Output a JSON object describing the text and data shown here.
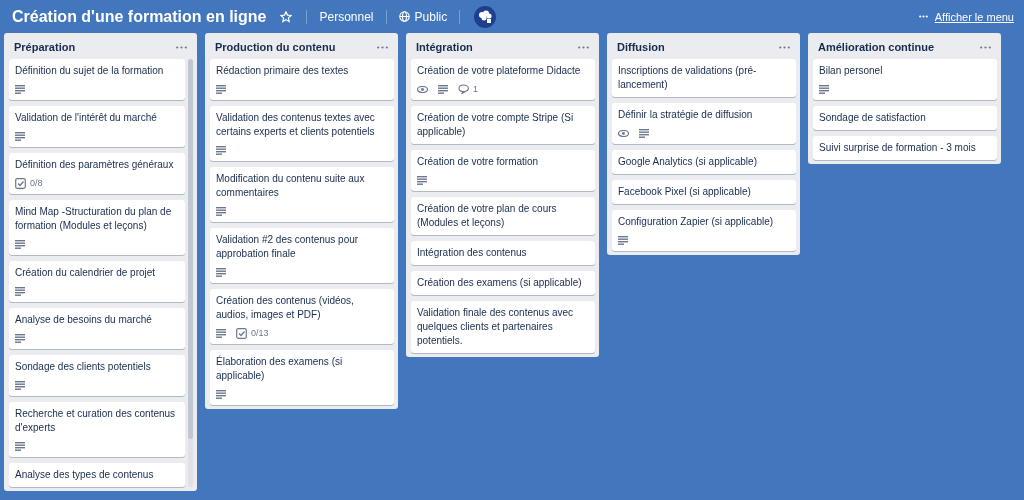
{
  "board": {
    "title": "Création d'une formation en ligne",
    "starred": false,
    "team": "Personnel",
    "visibility": "Public",
    "menu_link": "Afficher le menu"
  },
  "lists": [
    {
      "title": "Préparation",
      "scrollbar": true,
      "cards": [
        {
          "title": "Définition du sujet de la formation",
          "badges": [
            {
              "kind": "description"
            }
          ]
        },
        {
          "title": "Validation de l'intérêt du marché",
          "badges": [
            {
              "kind": "description"
            }
          ]
        },
        {
          "title": "Définition des paramètres généraux",
          "badges": [
            {
              "kind": "checklist",
              "text": "0/8"
            }
          ]
        },
        {
          "title": "Mind Map -Structuration du plan de formation (Modules et leçons)",
          "badges": [
            {
              "kind": "description"
            }
          ]
        },
        {
          "title": "Création du calendrier de projet",
          "badges": [
            {
              "kind": "description"
            }
          ]
        },
        {
          "title": "Analyse de besoins du marché",
          "badges": [
            {
              "kind": "description"
            }
          ]
        },
        {
          "title": "Sondage des clients potentiels",
          "badges": [
            {
              "kind": "description"
            }
          ]
        },
        {
          "title": "Recherche et curation des contenus d'experts",
          "badges": [
            {
              "kind": "description"
            }
          ]
        },
        {
          "title": "Analyse des types de contenus"
        }
      ]
    },
    {
      "title": "Production du contenu",
      "cards": [
        {
          "title": "Rédaction primaire des textes",
          "badges": [
            {
              "kind": "description"
            }
          ]
        },
        {
          "title": "Validation des contenus textes avec certains experts et clients potentiels",
          "badges": [
            {
              "kind": "description"
            }
          ]
        },
        {
          "title": "Modification du contenu suite aux commentaires",
          "badges": [
            {
              "kind": "description"
            }
          ]
        },
        {
          "title": "Validation #2 des contenus pour approbation finale",
          "badges": [
            {
              "kind": "description"
            }
          ]
        },
        {
          "title": "Création des contenus (vidéos, audios, images et PDF)",
          "badges": [
            {
              "kind": "description"
            },
            {
              "kind": "checklist",
              "text": "0/13"
            }
          ]
        },
        {
          "title": "Élaboration des examens (si applicable)",
          "badges": [
            {
              "kind": "description"
            }
          ]
        }
      ]
    },
    {
      "title": "Intégration",
      "cards": [
        {
          "title": "Création de votre plateforme Didacte",
          "badges": [
            {
              "kind": "watch"
            },
            {
              "kind": "description"
            },
            {
              "kind": "comments",
              "text": "1"
            }
          ]
        },
        {
          "title": "Création de votre compte Stripe (Si applicable)"
        },
        {
          "title": "Création de votre formation",
          "badges": [
            {
              "kind": "description"
            }
          ]
        },
        {
          "title": "Création de votre plan de cours (Modules et leçons)"
        },
        {
          "title": "Intégration des contenus"
        },
        {
          "title": "Création des examens (si applicable)"
        },
        {
          "title": "Validation finale des contenus avec quelques clients et partenaires potentiels."
        }
      ]
    },
    {
      "title": "Diffusion",
      "cards": [
        {
          "title": "Inscriptions de validations (pré-lancement)"
        },
        {
          "title": "Définir la stratégie de diffusion",
          "badges": [
            {
              "kind": "watch"
            },
            {
              "kind": "description"
            }
          ]
        },
        {
          "title": "Google Analytics (si applicable)"
        },
        {
          "title": "Facebook Pixel (si applicable)"
        },
        {
          "title": "Configuration Zapier (si applicable)",
          "badges": [
            {
              "kind": "description"
            }
          ]
        }
      ]
    },
    {
      "title": "Amélioration continue",
      "cards": [
        {
          "title": "Bilan personel",
          "badges": [
            {
              "kind": "description"
            }
          ]
        },
        {
          "title": "Sondage de satisfaction"
        },
        {
          "title": "Suivi surprise de formation - 3 mois"
        }
      ]
    }
  ]
}
